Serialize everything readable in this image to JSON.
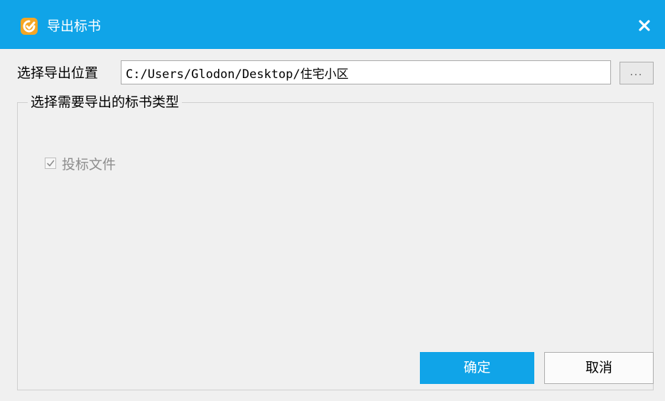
{
  "window": {
    "title": "导出标书",
    "app_icon": "glodon-app-icon",
    "close_icon": "close-icon"
  },
  "location": {
    "label": "选择导出位置",
    "path_value": "C:/Users/Glodon/Desktop/住宅小区",
    "browse_label": "..."
  },
  "group": {
    "legend": "选择需要导出的标书类型",
    "options": [
      {
        "label": "投标文件",
        "checked": true,
        "disabled": true
      }
    ]
  },
  "buttons": {
    "ok_label": "确定",
    "cancel_label": "取消"
  },
  "colors": {
    "accent": "#10a4e8",
    "icon_orange": "#f5a623",
    "background": "#f0f0f0"
  }
}
